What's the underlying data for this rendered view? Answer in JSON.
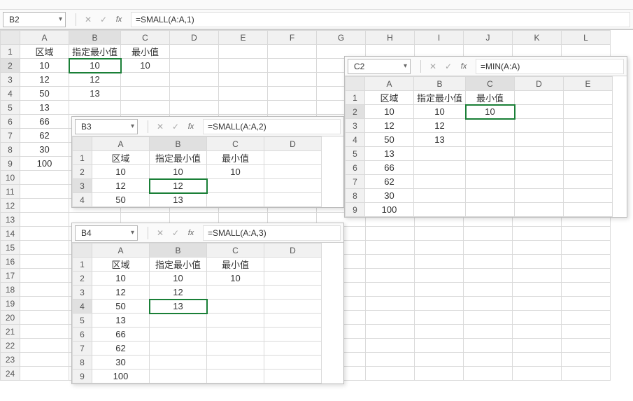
{
  "main": {
    "name_box": "B2",
    "formula": "=SMALL(A:A,1)",
    "headers": [
      "A",
      "B",
      "C",
      "D",
      "E",
      "F",
      "G",
      "H",
      "I",
      "J",
      "K",
      "L"
    ],
    "rows": 24,
    "data": {
      "A1": "区域",
      "B1": "指定最小值",
      "C1": "最小值",
      "A2": "10",
      "B2": "10",
      "C2": "10",
      "A3": "12",
      "B3": "12",
      "A4": "50",
      "B4": "13",
      "A5": "13",
      "A6": "66",
      "A7": "62",
      "A8": "30",
      "A9": "100"
    },
    "selected": "B2"
  },
  "floatB3": {
    "name_box": "B3",
    "formula": "=SMALL(A:A,2)",
    "headers": [
      "A",
      "B",
      "C",
      "D"
    ],
    "rows": 4,
    "data": {
      "A1": "区域",
      "B1": "指定最小值",
      "C1": "最小值",
      "A2": "10",
      "B2": "10",
      "C2": "10",
      "A3": "12",
      "B3": "12",
      "A4": "50",
      "B4": "13"
    },
    "selected": "B3"
  },
  "floatB4": {
    "name_box": "B4",
    "formula": "=SMALL(A:A,3)",
    "headers": [
      "A",
      "B",
      "C",
      "D"
    ],
    "rows": 9,
    "data": {
      "A1": "区域",
      "B1": "指定最小值",
      "C1": "最小值",
      "A2": "10",
      "B2": "10",
      "C2": "10",
      "A3": "12",
      "B3": "12",
      "A4": "50",
      "B4": "13",
      "A5": "13",
      "A6": "66",
      "A7": "62",
      "A8": "30",
      "A9": "100"
    },
    "selected": "B4"
  },
  "floatC2": {
    "name_box": "C2",
    "formula": "=MIN(A:A)",
    "headers": [
      "A",
      "B",
      "C",
      "D",
      "E"
    ],
    "rows": 9,
    "data": {
      "A1": "区域",
      "B1": "指定最小值",
      "C1": "最小值",
      "A2": "10",
      "B2": "10",
      "C2": "10",
      "A3": "12",
      "B3": "12",
      "A4": "50",
      "B4": "13",
      "A5": "13",
      "A6": "66",
      "A7": "62",
      "A8": "30",
      "A9": "100"
    },
    "selected": "C2"
  }
}
